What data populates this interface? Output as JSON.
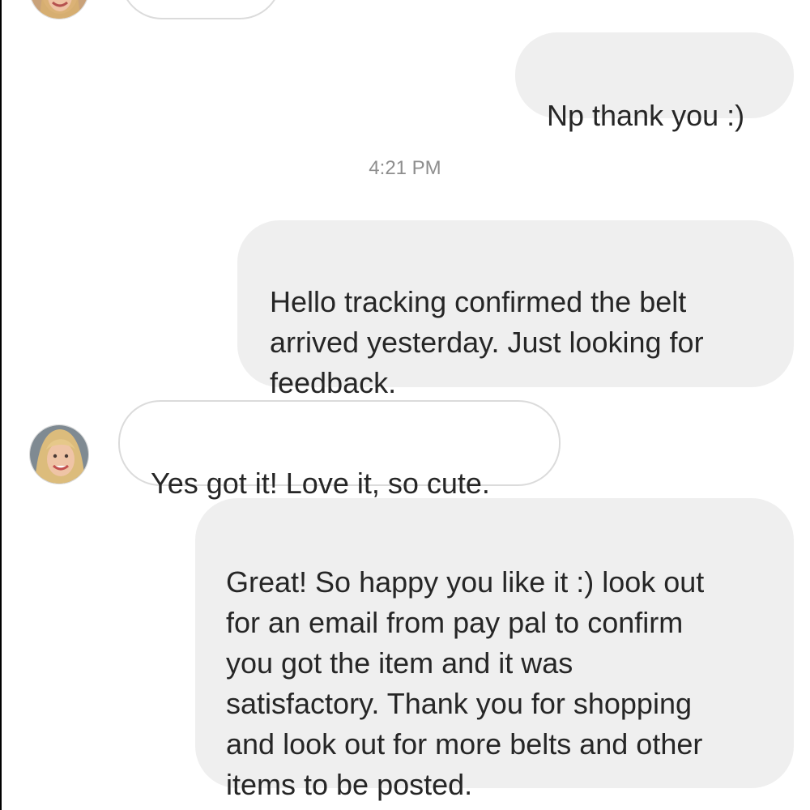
{
  "timestamp": "4:21 PM",
  "messages": [
    {
      "from": "me",
      "text": "Np thank you :)"
    },
    {
      "from": "me",
      "text": "Hello tracking confirmed the belt\narrived yesterday.  Just looking for\nfeedback."
    },
    {
      "from": "them",
      "text": "Yes got it!  Love it, so cute."
    },
    {
      "from": "me",
      "text": "Great!  So happy you like it :) look out\nfor an email from pay pal to confirm\nyou got the item and it was\nsatisfactory.  Thank you for shopping\nand look out for more belts and other\nitems to be posted."
    }
  ],
  "colors": {
    "sent_bubble": "#efefef",
    "received_border": "#dbdbdb",
    "timestamp": "#8e8e8e",
    "text": "#262626"
  },
  "icons": {
    "avatar": "contact-avatar"
  }
}
